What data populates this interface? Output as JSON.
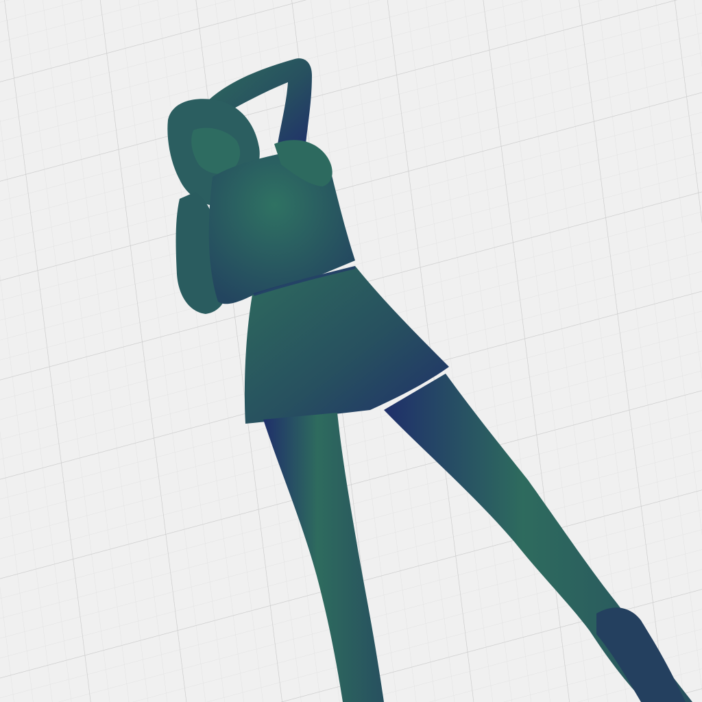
{
  "viewport": {
    "background_color": "#f0f0f0",
    "grid": {
      "visible": true,
      "minor_color": "#e2e2e2",
      "major_color": "#c9c9c9"
    }
  },
  "model": {
    "kind": "3d-mesh",
    "subject": "standing-figure",
    "shading_colors": [
      "#2e6b5e",
      "#27505f",
      "#1f2f6a"
    ]
  }
}
